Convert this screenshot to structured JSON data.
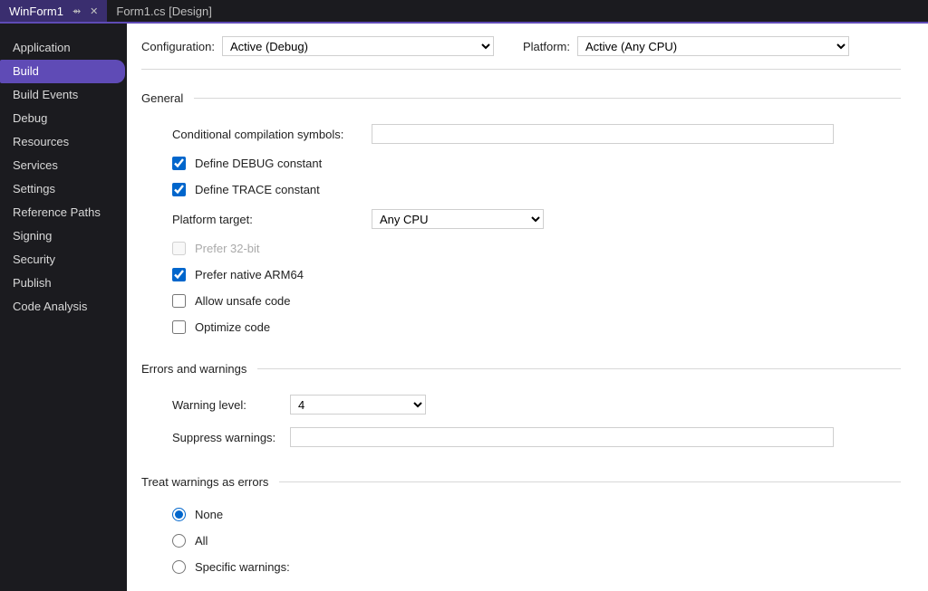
{
  "tabs": [
    {
      "title": "WinForm1",
      "active": true,
      "pinned": true
    },
    {
      "title": "Form1.cs [Design]",
      "active": false
    }
  ],
  "sidebar": {
    "items": [
      "Application",
      "Build",
      "Build Events",
      "Debug",
      "Resources",
      "Services",
      "Settings",
      "Reference Paths",
      "Signing",
      "Security",
      "Publish",
      "Code Analysis"
    ],
    "selected": 1
  },
  "top": {
    "configuration_label": "Configuration:",
    "configuration_value": "Active (Debug)",
    "platform_label": "Platform:",
    "platform_value": "Active (Any CPU)"
  },
  "general": {
    "header": "General",
    "cond_symbols_label": "Conditional compilation symbols:",
    "cond_symbols_value": "",
    "define_debug_label": "Define DEBUG constant",
    "define_debug_checked": true,
    "define_trace_label": "Define TRACE constant",
    "define_trace_checked": true,
    "platform_target_label": "Platform target:",
    "platform_target_value": "Any CPU",
    "prefer_32bit_label": "Prefer 32-bit",
    "prefer_32bit_checked": false,
    "prefer_32bit_enabled": false,
    "prefer_arm64_label": "Prefer native ARM64",
    "prefer_arm64_checked": true,
    "allow_unsafe_label": "Allow unsafe code",
    "allow_unsafe_checked": false,
    "optimize_label": "Optimize code",
    "optimize_checked": false
  },
  "warnings": {
    "header": "Errors and warnings",
    "warning_level_label": "Warning level:",
    "warning_level_value": "4",
    "suppress_label": "Suppress warnings:",
    "suppress_value": ""
  },
  "treat": {
    "header": "Treat warnings as errors",
    "none_label": "None",
    "all_label": "All",
    "specific_label": "Specific warnings:",
    "selected": "none"
  }
}
